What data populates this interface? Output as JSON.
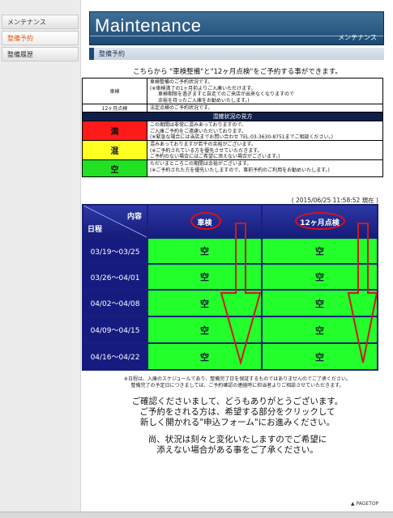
{
  "sidebar": {
    "items": [
      {
        "label": "メンテナンス",
        "active": false
      },
      {
        "label": "整備予約",
        "active": true
      },
      {
        "label": "整備履歴",
        "active": false
      }
    ]
  },
  "header": {
    "title_en": "Maintenance",
    "title_jp": "メンテナンス",
    "section": "整備予約"
  },
  "intro": "こちらから \"車検整備\"と\"12ヶ月点検\"をご予約する事ができます。",
  "legend": {
    "services": [
      {
        "label": "車検",
        "lines": [
          "車検整備のご予約状況です。",
          "(※車検満了の1ヶ月前よりご入庫いただけます。",
          "車検期限を過ぎますと自走でのご来店が出来なくなりますので",
          "余裕を持ったご入庫をお勧めいたします。)"
        ]
      },
      {
        "label": "12ヶ月点検",
        "lines": [
          "法定点検のご予約状況です。"
        ]
      }
    ],
    "heading": "混雑状況の見方",
    "statuses": [
      {
        "symbol": "満",
        "lines": [
          "この期間は非常に混みあっておりますので、",
          "ご入庫ご予約をご遠慮いただいております。",
          "(※緊急な場合には当店までお問い合わせ TEL:03-3630-8751までご相談ください。)"
        ]
      },
      {
        "symbol": "混",
        "lines": [
          "混みあっておりますが若干の余裕がございます。",
          "(※ご予約されている方を優先させていただきます。",
          "ご予約のない場合にはご希望に添えない場合がございます。)"
        ]
      },
      {
        "symbol": "空",
        "lines": [
          "ただいまところこの期間は余裕がございます。",
          "(※ご予約された方を優先いたしますので、事前予約のご利用をお勧めいたします。)"
        ]
      }
    ]
  },
  "schedule": {
    "timestamp": "( 2015/06/25 11:58:52 現在 )",
    "header_content": "内容",
    "header_date": "日程",
    "col1": "車検",
    "col2": "12ヶ月点検",
    "rows": [
      {
        "period": "03/19～03/25",
        "shaken": "空",
        "tenken": "空"
      },
      {
        "period": "03/26～04/01",
        "shaken": "空",
        "tenken": "空"
      },
      {
        "period": "04/02～04/08",
        "shaken": "空",
        "tenken": "空"
      },
      {
        "period": "04/09～04/15",
        "shaken": "空",
        "tenken": "空"
      },
      {
        "period": "04/16～04/22",
        "shaken": "空",
        "tenken": "空"
      }
    ]
  },
  "note": [
    "※日程は、入庫のスケジュールであり、整備完了日を保証するものではありませんのでご了承ください。",
    "整備完了の予定日につきましては、ご予約確認の連絡時に担当者よりご相談させていただきます。"
  ],
  "thanks": [
    "ご確認くださいまして、どうもありがとうございます。",
    "ご予約をされる方は、希望する部分をクリックして",
    "新しく開かれる\"申込フォーム\"にお進みください。"
  ],
  "caution": [
    "尚、状況は刻々と変化いたしますのでご希望に",
    "添えない場合がある事をご了承ください。"
  ],
  "pagetop": "PAGETOP",
  "colors": {
    "full": "#ff1a1a",
    "crowded": "#ffff22",
    "available": "#22ff2a",
    "header_blue": "#161b80",
    "annotation_red": "#e10f0f"
  }
}
